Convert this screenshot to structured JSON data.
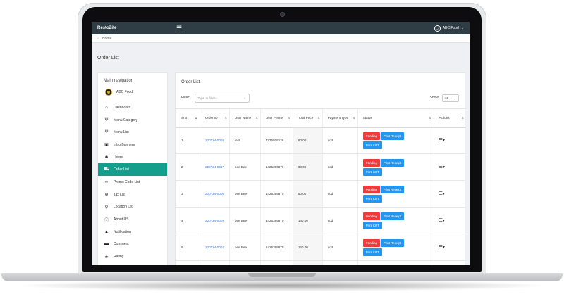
{
  "app": {
    "brand": "RestoZite",
    "user_name": "ABC Food"
  },
  "breadcrumb": {
    "home_label": "Home"
  },
  "page": {
    "title": "Order List"
  },
  "sidebar": {
    "heading": "Main navigation",
    "account_name": "ABC Food",
    "items": [
      {
        "label": "Dashboard",
        "icon": "home-icon",
        "glyph": "⌂"
      },
      {
        "label": "Menu Category",
        "icon": "cutlery-icon",
        "glyph": "Ψ"
      },
      {
        "label": "Menu List",
        "icon": "cutlery-icon",
        "glyph": "Ψ"
      },
      {
        "label": "Intro Banners",
        "icon": "image-icon",
        "glyph": "▣"
      },
      {
        "label": "Users",
        "icon": "users-icon",
        "glyph": "☻"
      },
      {
        "label": "Order List",
        "icon": "cart-icon",
        "glyph": "⛟",
        "active": true
      },
      {
        "label": "Promo Code List",
        "icon": "link-icon",
        "glyph": "∞"
      },
      {
        "label": "Tax List",
        "icon": "globe-icon",
        "glyph": "⊕"
      },
      {
        "label": "Location List",
        "icon": "location-pin-icon",
        "glyph": "⚲"
      },
      {
        "label": "About US",
        "icon": "info-icon",
        "glyph": "ⓘ"
      },
      {
        "label": "Notification",
        "icon": "bell-icon",
        "glyph": "▲"
      },
      {
        "label": "Comment",
        "icon": "comment-icon",
        "glyph": "▬"
      },
      {
        "label": "Rating",
        "icon": "star-icon",
        "glyph": "★"
      }
    ]
  },
  "card": {
    "title": "Order List",
    "filter_label": "Filter:",
    "filter_placeholder": "Type to filter...",
    "show_label": "Show",
    "show_value": "10"
  },
  "table": {
    "headers": [
      "Sno",
      "Order ID",
      "User Name",
      "User Phone",
      "Total Price",
      "Payment Type",
      "Status",
      "Actions"
    ],
    "buttons": {
      "pending": "Pending",
      "receipt": "Print Receipt",
      "kot": "Print KOT"
    },
    "rows": [
      {
        "sno": "1",
        "order_id": "200724-0008",
        "user_name": "test",
        "phone": "7776919126",
        "price": "90.00",
        "payment": "cod"
      },
      {
        "sno": "2",
        "order_id": "200724-0007",
        "user_name": "bee Bee",
        "phone": "1425399870",
        "price": "90.00",
        "payment": "cod"
      },
      {
        "sno": "3",
        "order_id": "200724-0006",
        "user_name": "bee Bee",
        "phone": "1425399870",
        "price": "90.00",
        "payment": "cod"
      },
      {
        "sno": "4",
        "order_id": "200724-0005",
        "user_name": "bee Bee",
        "phone": "1425399870",
        "price": "140.00",
        "payment": "cod"
      },
      {
        "sno": "5",
        "order_id": "200724-0004",
        "user_name": "bee Bee",
        "phone": "1425399870",
        "price": "140.00",
        "payment": "cod"
      },
      {
        "sno": "",
        "order_id": "",
        "user_name": "",
        "phone": "",
        "price": "",
        "payment": ""
      }
    ]
  },
  "colors": {
    "topbar": "#2f3d45",
    "active": "#169e8c",
    "pending": "#ef3b3b",
    "print": "#2196f3",
    "link": "#3a7bd5"
  }
}
